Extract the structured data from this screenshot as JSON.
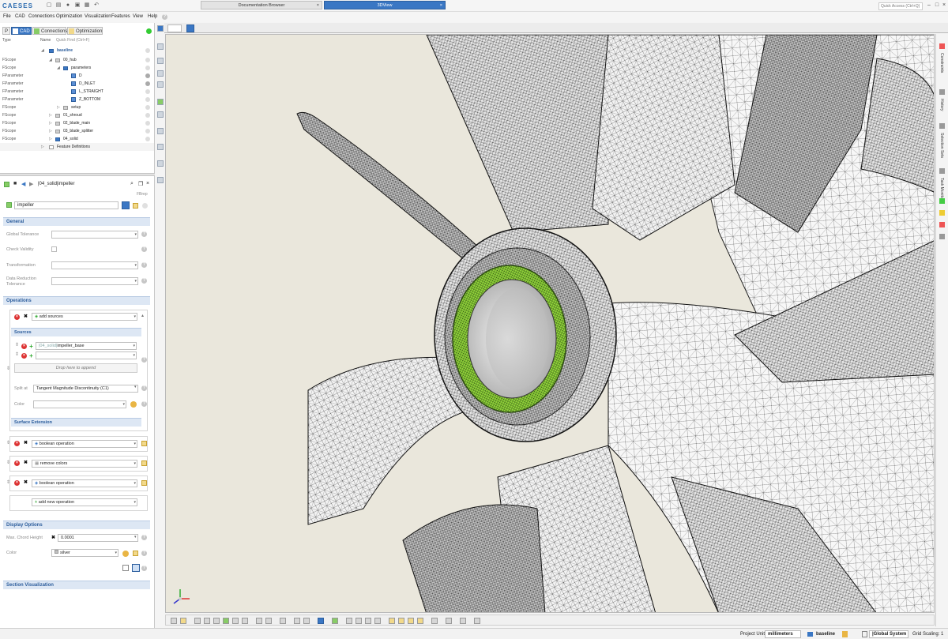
{
  "app": {
    "logo": "CAESES",
    "quick_access_placeholder": "Quick Access (Ctrl+Q)"
  },
  "menu": [
    "File",
    "CAD",
    "Connections",
    "Optimization",
    "Visualization",
    "Features",
    "View",
    "Help"
  ],
  "left_tabs": [
    {
      "label": "P"
    },
    {
      "label": "CAD"
    },
    {
      "label": "Connections"
    },
    {
      "label": "Optimization"
    }
  ],
  "tree": {
    "col_type": "Type",
    "col_name": "Name",
    "quick_find": "Quick Find (Ctrl+F)",
    "rows": [
      {
        "type": "",
        "name": "baseline"
      },
      {
        "type": "FScope",
        "name": "00_hub"
      },
      {
        "type": "FScope",
        "name": "parameters"
      },
      {
        "type": "FParameter",
        "name": "D"
      },
      {
        "type": "FParameter",
        "name": "D_INLET"
      },
      {
        "type": "FParameter",
        "name": "L_STRAIGHT"
      },
      {
        "type": "FParameter",
        "name": "Z_BOTTOM"
      },
      {
        "type": "FScope",
        "name": "setup"
      },
      {
        "type": "FScope",
        "name": "01_shroud"
      },
      {
        "type": "FScope",
        "name": "02_blade_main"
      },
      {
        "type": "FScope",
        "name": "03_blade_splitter"
      },
      {
        "type": "FScope",
        "name": "04_solid"
      },
      {
        "type": "",
        "name": "Feature Definitions"
      }
    ]
  },
  "editor": {
    "path": "|04_solid|impeller",
    "type_tag": "FBrep",
    "name": "impeller",
    "general": {
      "title": "General",
      "global_tolerance": "Global Tolerance",
      "check_validity": "Check Validity",
      "transformation": "Transformation",
      "data_reduction": "Data Reduction Tolerance"
    },
    "operations": {
      "title": "Operations",
      "add_sources": "add sources",
      "sources_title": "Sources",
      "source_prefix": "|04_solid|",
      "source_name": "impeller_base",
      "drop_here": "Drop here to append",
      "split_at_label": "Split at",
      "split_at_value": "Tangent Magnitude Discontinuity (C1)",
      "color_label": "Color",
      "surface_extension": "Surface Extension",
      "op1": "boolean operation",
      "op2": "remove colors",
      "op3": "boolean operation",
      "add_new": "add new operation"
    },
    "display": {
      "title": "Display Options",
      "chord_label": "Max. Chord Height",
      "chord_value": "0.0001",
      "color_label": "Color",
      "color_value": "silver"
    },
    "section_visualization": "Section Visualization"
  },
  "view_tabs": [
    {
      "label": "Documentation Browser"
    },
    {
      "label": "3DView"
    }
  ],
  "right_panel_tabs": [
    "Constraints",
    "History",
    "Selection Sets",
    "Task Monitor"
  ],
  "status": {
    "project_units_label": "Project Units:",
    "project_units": "millimeters",
    "design": "baseline",
    "system": "|Global System",
    "grid_scaling": "Grid Scaling: 1"
  },
  "colors": {
    "accent": "#3a77c4",
    "highlight_ring": "#8fd13a"
  }
}
